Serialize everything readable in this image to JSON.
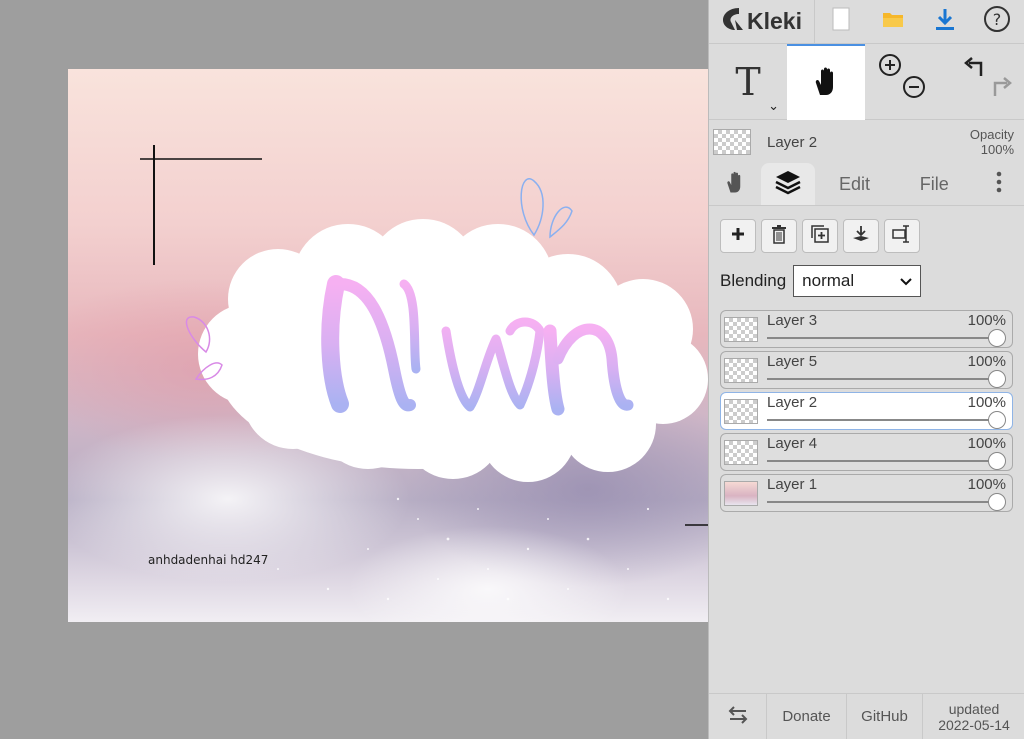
{
  "app": {
    "name": "Kleki"
  },
  "canvas": {
    "watermark_text": "anhdadenhai hd247"
  },
  "toolbar": {
    "text_tool_label": "T"
  },
  "current_layer": {
    "name": "Layer 2",
    "opacity_label": "Opacity",
    "opacity_value": "100%"
  },
  "tabs": {
    "edit": "Edit",
    "file": "File"
  },
  "blending": {
    "label": "Blending",
    "value": "normal"
  },
  "layers": [
    {
      "name": "Layer 3",
      "opacity": "100%"
    },
    {
      "name": "Layer 5",
      "opacity": "100%"
    },
    {
      "name": "Layer 2",
      "opacity": "100%"
    },
    {
      "name": "Layer 4",
      "opacity": "100%"
    },
    {
      "name": "Layer 1",
      "opacity": "100%"
    }
  ],
  "footer": {
    "donate": "Donate",
    "github": "GitHub",
    "updated_label": "updated",
    "updated_date": "2022-05-14"
  },
  "colors": {
    "accent": "#4a90e2",
    "download": "#1976d2",
    "open": "#f6b72a"
  }
}
